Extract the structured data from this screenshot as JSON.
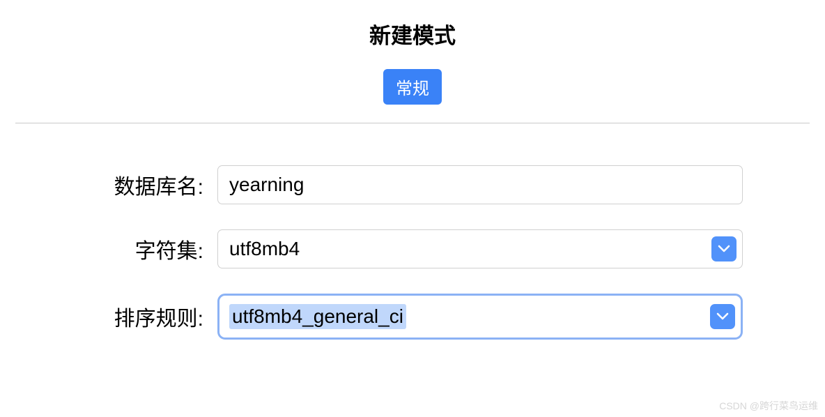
{
  "title": "新建模式",
  "tab": {
    "active_label": "常规"
  },
  "form": {
    "db_name": {
      "label": "数据库名:",
      "value": "yearning"
    },
    "charset": {
      "label": "字符集:",
      "value": "utf8mb4"
    },
    "collation": {
      "label": "排序规则:",
      "value": "utf8mb4_general_ci"
    }
  },
  "watermark": "CSDN @跨行菜鸟运维"
}
